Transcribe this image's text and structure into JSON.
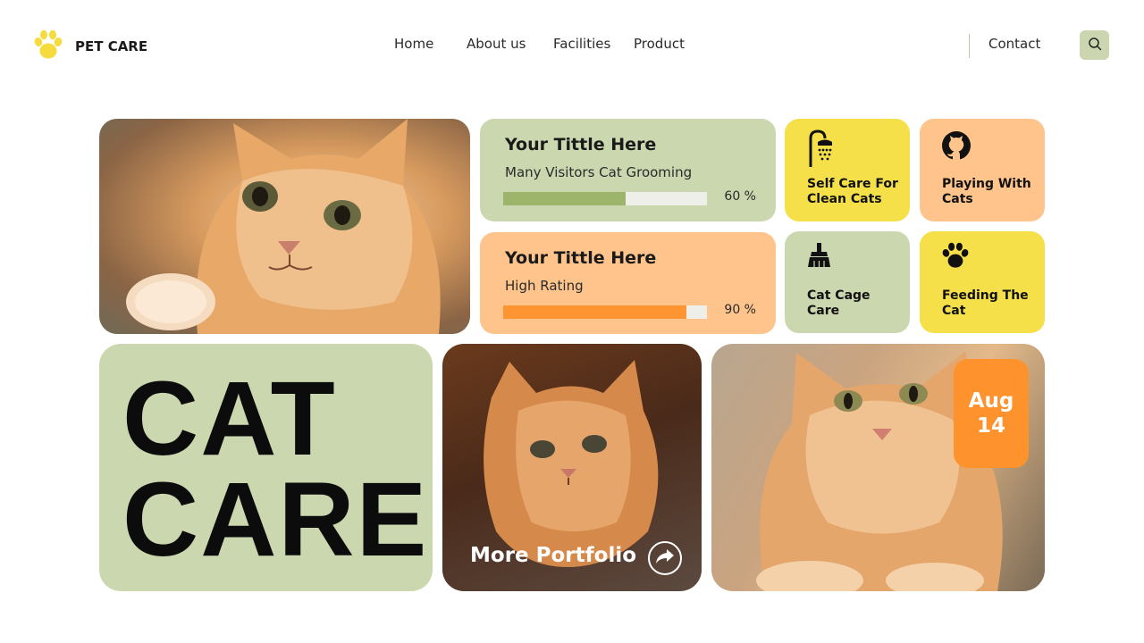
{
  "brand": {
    "name": "PET CARE",
    "logo_icon": "paw-icon",
    "accent": "#f5dc3c"
  },
  "nav": {
    "items": [
      "Home",
      "About us",
      "Facilities",
      "Product"
    ],
    "contact": "Contact",
    "search_icon": "search-icon"
  },
  "stats": [
    {
      "title": "Your Tittle Here",
      "subtitle": "Many Visitors Cat Grooming",
      "percent": 60,
      "percent_label": "60 %",
      "bar_color": "#9db56a"
    },
    {
      "title": "Your Tittle Here",
      "subtitle": "High Rating",
      "percent": 90,
      "percent_label": "90 %",
      "bar_color": "#fe9432"
    }
  ],
  "services": [
    {
      "label": "Self Care For Clean Cats",
      "icon": "shower-icon"
    },
    {
      "label": "Playing With Cats",
      "icon": "github-icon"
    },
    {
      "label": "Cat Cage Care",
      "icon": "broom-icon"
    },
    {
      "label": "Feeding The Cat",
      "icon": "paw-icon"
    }
  ],
  "hero": {
    "line1": "CAT",
    "line2": "CARE"
  },
  "portfolio": {
    "label": "More Portfolio",
    "icon": "share-arrow-icon"
  },
  "date": {
    "month": "Aug",
    "day": "14"
  },
  "colors": {
    "green": "#cbd7ae",
    "peach": "#fec48c",
    "yellow": "#f5e04a",
    "orange": "#fe922d"
  }
}
